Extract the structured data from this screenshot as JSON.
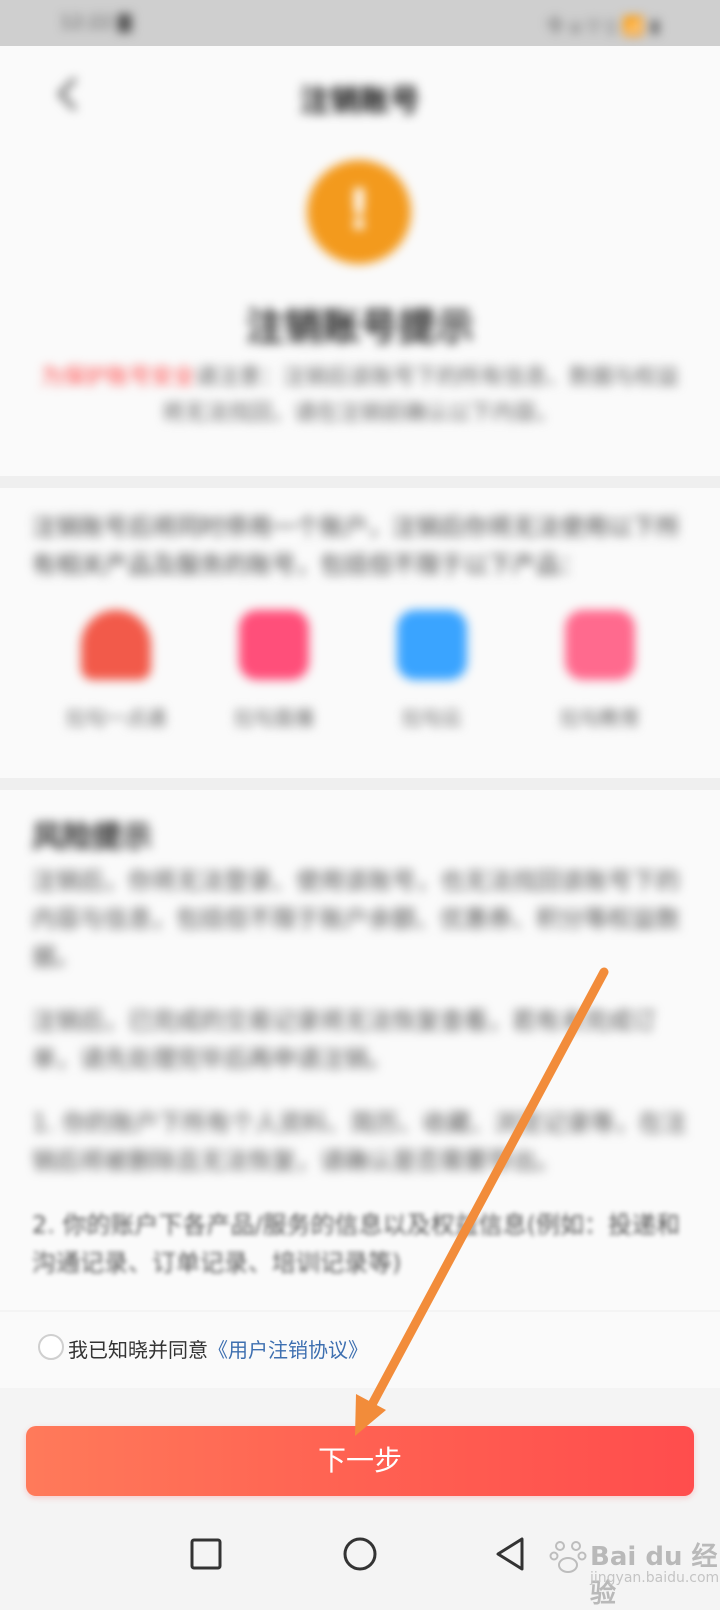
{
  "status_bar": {
    "time": "12:22 ▇",
    "icons": "令 ⌂ ▽ ▯ 📶 ▮"
  },
  "header": {
    "title": "注销账号"
  },
  "hero": {
    "icon": "warning-exclamation-icon",
    "title": "注销账号提示",
    "desc_highlight": "为保护账号安全",
    "desc": "请注意：注销后该账号下的所有信息、数据与权益将无法找回，请在注销前确认以下内容。"
  },
  "apps": {
    "desc": "注销账号后将同时停用一个账户，注销后你将无法使用以下所有相关产品及服务的账号，包括但不限于以下产品：",
    "items": [
      {
        "label": "拉勾一点通",
        "icon": "brand-red-icon",
        "color": "#f25a4a"
      },
      {
        "label": "拉勾直播",
        "icon": "pink-tv-icon",
        "color": "#ff4f7a"
      },
      {
        "label": "拉勾云",
        "icon": "blue-cloud-icon",
        "color": "#3aa4ff"
      },
      {
        "label": "拉勾教育",
        "icon": "pink-book-icon",
        "color": "#ff6a8e"
      }
    ]
  },
  "risk": {
    "title": "风险提示",
    "paragraphs": [
      "注销后，你将无法登录、使用该账号，也无法找回该账号下的内容与信息，包括但不限于账户余额、优惠券、积分等权益数据。",
      "注销后，已完成的交易记录将无法恢复查看，若有未完成订单，请先处理完毕后再申请注销。",
      "1. 你的账户下所有个人资料、简历、收藏、浏览记录等，在注销后将被删除且无法恢复，请确认是否需要导出。",
      "2. 你的账户下各产品/服务的信息以及权益信息(例如：投递和沟通记录、订单记录、培训记录等)"
    ]
  },
  "agree": {
    "prefix": "我已知晓并同意",
    "link": "《用户注销协议》"
  },
  "button": {
    "next": "下一步"
  },
  "nav": {
    "recent": "square-recent-apps-icon",
    "home": "circle-home-icon",
    "back": "triangle-back-icon"
  },
  "watermark": {
    "brand": "Bai du 经验",
    "url": "jingyan.baidu.com"
  },
  "annotation": {
    "color": "#f28c3a"
  }
}
